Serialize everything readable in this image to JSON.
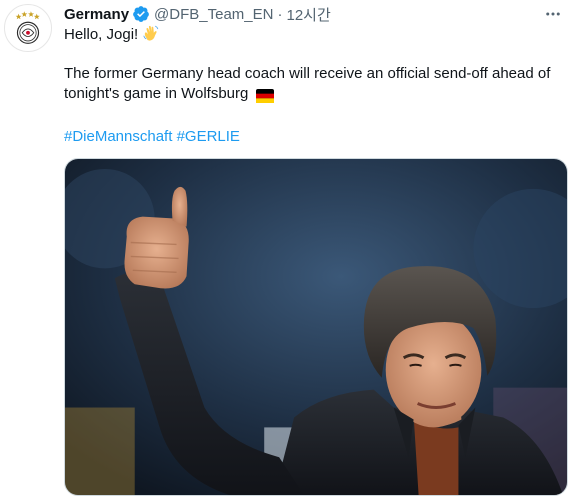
{
  "tweet": {
    "author": {
      "name": "Germany",
      "handle": "@DFB_Team_EN",
      "verified": true,
      "avatar_icon": "dfb-crest-icon"
    },
    "separator": "·",
    "time": "12시간",
    "more_icon": "more-horizontal-icon",
    "text": {
      "line1": "Hello, Jogi!",
      "line1_emoji": "waving-hand-emoji",
      "line2": "The former Germany head coach will receive an official send-off ahead of tonight's game in Wolfsburg",
      "line2_emoji": "germany-flag-emoji",
      "hashtags": [
        "#DieMannschaft",
        "#GERLIE"
      ]
    },
    "media": {
      "type": "photo",
      "subject": "man-giving-thumbs-up-photo"
    },
    "colors": {
      "link": "#1d9bf0",
      "verified": "#1d9bf0",
      "secondary_text": "#536471",
      "primary_text": "#0f1419"
    }
  }
}
